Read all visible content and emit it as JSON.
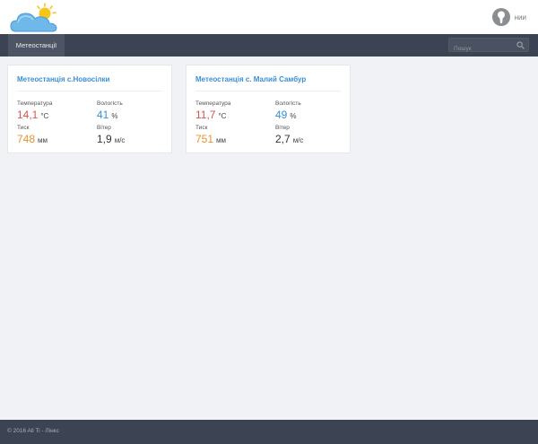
{
  "header": {
    "logo_icon": "sun-cloud-icon",
    "user_name": "нии"
  },
  "nav": {
    "tab_label": "Метеостанції",
    "search_placeholder": "Пошук"
  },
  "stations": [
    {
      "title": "Метеостанція с.Новосілки",
      "temperature": {
        "label": "Температура",
        "value": "14,1",
        "unit": "°C"
      },
      "humidity": {
        "label": "Вологість",
        "value": "41",
        "unit": "%"
      },
      "pressure": {
        "label": "Тиск",
        "value": "748",
        "unit": "мм"
      },
      "wind": {
        "label": "Вітер",
        "value": "1,9",
        "unit": "м/с"
      }
    },
    {
      "title": "Метеостанція с. Малий Самбур",
      "temperature": {
        "label": "Температура",
        "value": "11,7",
        "unit": "°C"
      },
      "humidity": {
        "label": "Вологість",
        "value": "49",
        "unit": "%"
      },
      "pressure": {
        "label": "Тиск",
        "value": "751",
        "unit": "мм"
      },
      "wind": {
        "label": "Вітер",
        "value": "2,7",
        "unit": "м/с"
      }
    }
  ],
  "footer": {
    "text": "© 2016 All Ti - Лінкс"
  },
  "colors": {
    "accent_blue": "#3a8fd6",
    "temperature_red": "#d9534f",
    "pressure_orange": "#e8922e",
    "navbar_bg": "#3c4352",
    "page_bg": "#f0f2f5"
  }
}
